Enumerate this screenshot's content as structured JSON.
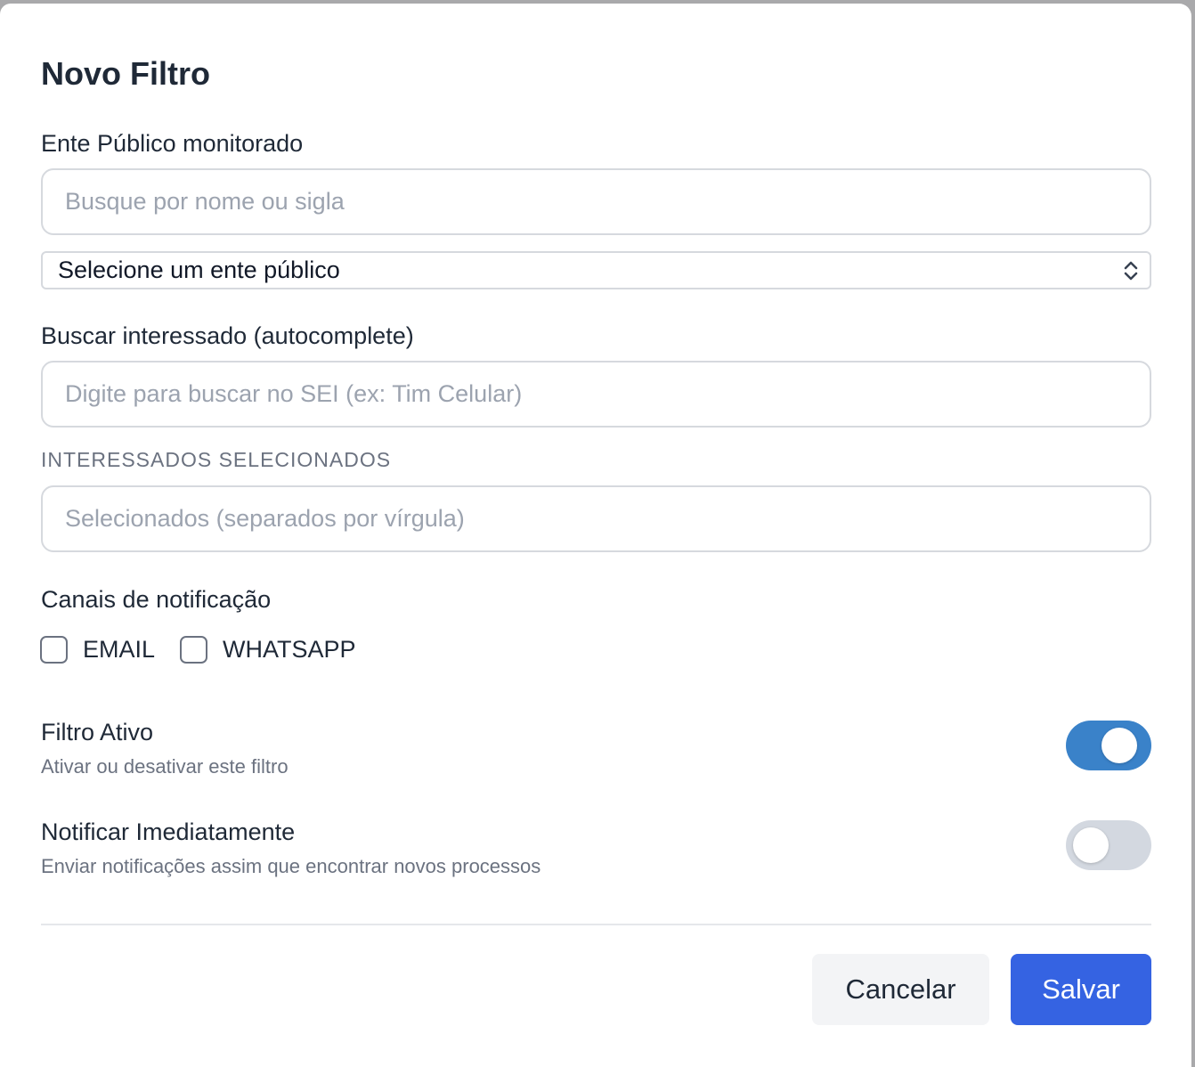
{
  "modal": {
    "title": "Novo Filtro"
  },
  "ente": {
    "label": "Ente Público monitorado",
    "search_placeholder": "Busque por nome ou sigla",
    "select_value": "Selecione um ente público"
  },
  "interessado": {
    "label": "Buscar interessado (autocomplete)",
    "search_placeholder": "Digite para buscar no SEI (ex: Tim Celular)",
    "selected_label": "INTERESSADOS SELECIONADOS",
    "selected_placeholder": "Selecionados (separados por vírgula)"
  },
  "canais": {
    "label": "Canais de notificação",
    "options": [
      {
        "label": "EMAIL",
        "checked": false
      },
      {
        "label": "WHATSAPP",
        "checked": false
      }
    ]
  },
  "toggles": {
    "ativo": {
      "title": "Filtro Ativo",
      "subtitle": "Ativar ou desativar este filtro",
      "on": true
    },
    "imediato": {
      "title": "Notificar Imediatamente",
      "subtitle": "Enviar notificações assim que encontrar novos processos",
      "on": false
    }
  },
  "footer": {
    "cancel_label": "Cancelar",
    "save_label": "Salvar"
  },
  "colors": {
    "primary": "#3563e2",
    "toggle_on": "#3a82c9",
    "toggle_off": "#d3d8e0"
  }
}
